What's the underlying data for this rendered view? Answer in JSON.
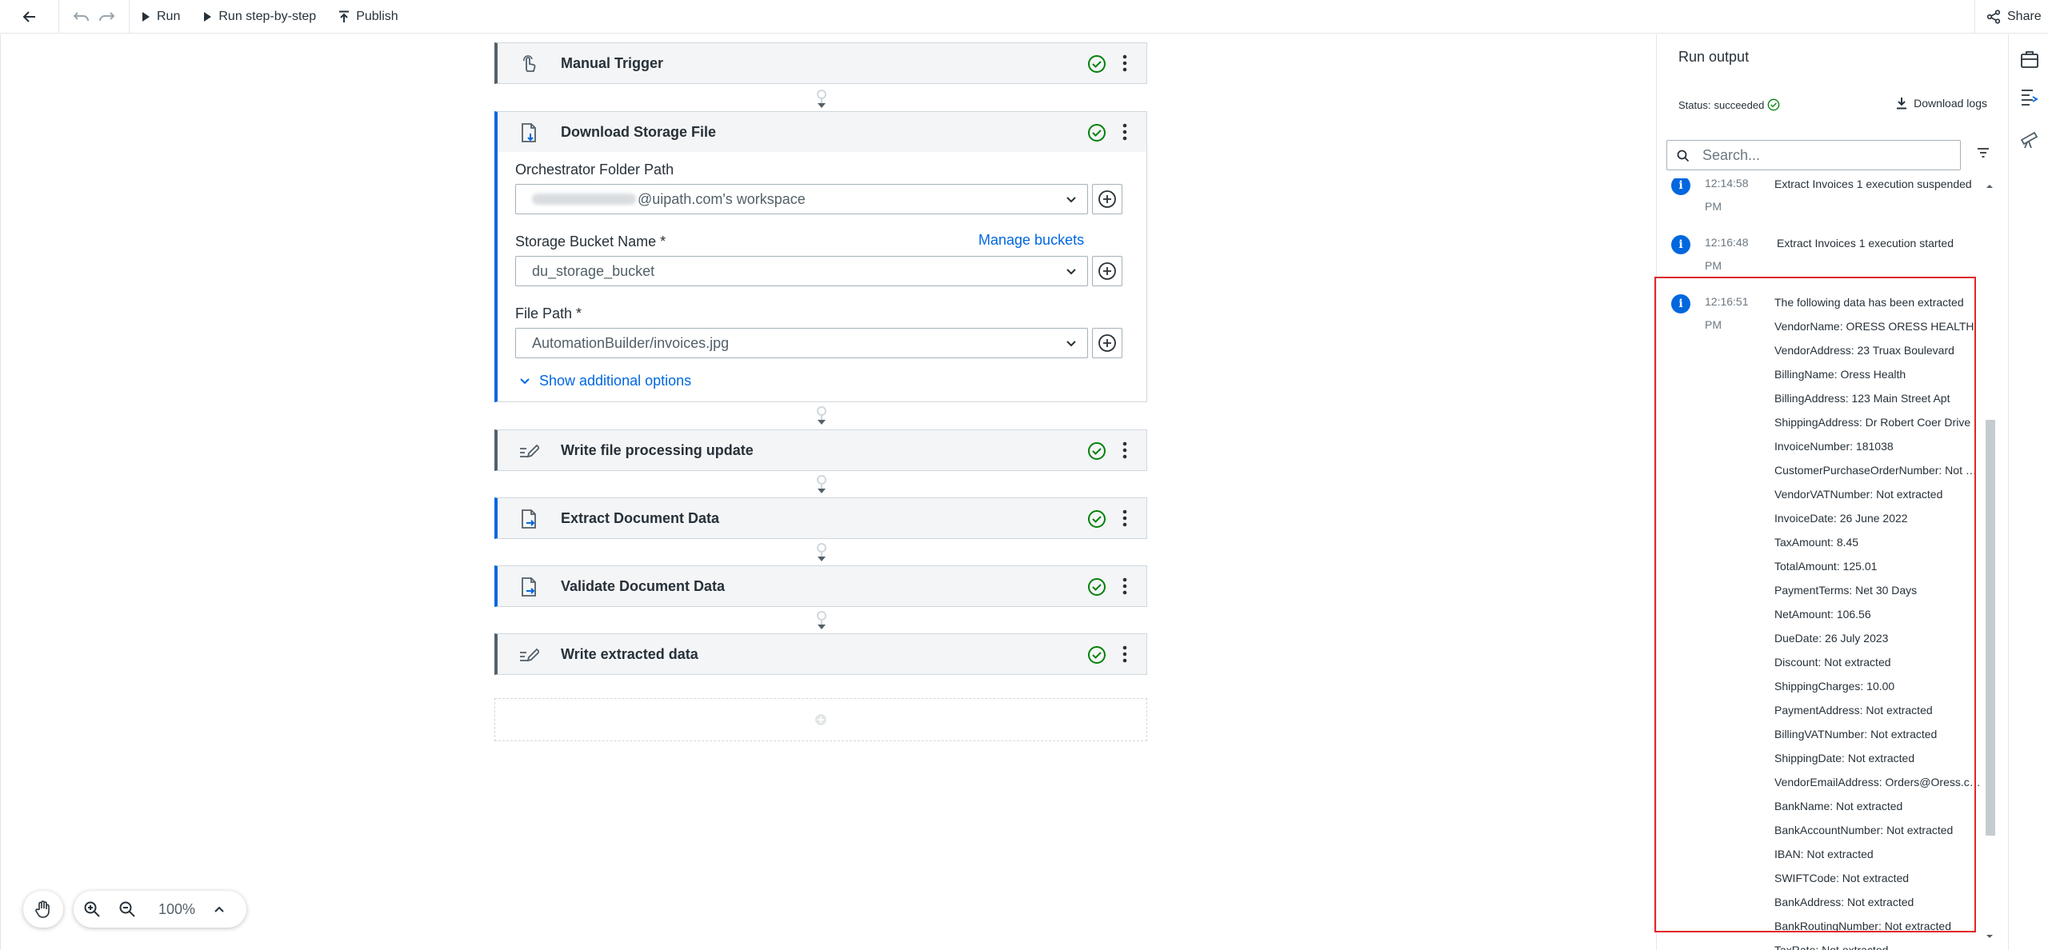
{
  "toolbar": {
    "run_label": "Run",
    "run_step_label": "Run step-by-step",
    "publish_label": "Publish",
    "share_label": "Share"
  },
  "workflow": {
    "nodes": [
      {
        "title": "Manual Trigger"
      },
      {
        "title": "Download Storage File"
      },
      {
        "title": "Write file processing update"
      },
      {
        "title": "Extract Document Data"
      },
      {
        "title": "Validate Document Data"
      },
      {
        "title": "Write extracted data"
      }
    ],
    "download_form": {
      "folder_label": "Orchestrator Folder Path",
      "folder_value": "@uipath.com's workspace",
      "bucket_label": "Storage Bucket Name *",
      "manage_buckets": "Manage buckets",
      "bucket_value": "du_storage_bucket",
      "filepath_label": "File Path *",
      "filepath_value": "AutomationBuilder/invoices.jpg",
      "show_more": "Show additional options"
    }
  },
  "zoom": {
    "level": "100%"
  },
  "run_output": {
    "title": "Run output",
    "status_label": "Status:",
    "status_value": "succeeded",
    "download_logs": "Download logs",
    "search_placeholder": "Search...",
    "entries": [
      {
        "time": "12:14:58 PM",
        "message": "Extract Invoices 1 execution suspended"
      },
      {
        "time": "12:16:48 PM",
        "message": "Extract Invoices 1 execution started"
      },
      {
        "time": "12:16:51 PM",
        "lines": [
          "The following data has been extracted",
          "VendorName: ORESS ORESS HEALTH",
          "VendorAddress: 23 Truax Boulevard",
          "BillingName: Oress Health",
          "BillingAddress: 123 Main Street Apt",
          "ShippingAddress: Dr Robert Coer Drive",
          "InvoiceNumber: 181038",
          "CustomerPurchaseOrderNumber: Not extracted",
          "VendorVATNumber: Not extracted",
          "InvoiceDate: 26 June 2022",
          "TaxAmount: 8.45",
          "TotalAmount: 125.01",
          "PaymentTerms: Net 30 Days",
          "NetAmount: 106.56",
          "DueDate: 26 July 2023",
          "Discount: Not extracted",
          "ShippingCharges: 10.00",
          "PaymentAddress: Not extracted",
          "BillingVATNumber: Not extracted",
          "ShippingDate: Not extracted",
          "VendorEmailAddress: Orders@Oress.com",
          "BankName: Not extracted",
          "BankAccountNumber: Not extracted",
          "IBAN: Not extracted",
          "SWIFTCode: Not extracted",
          "BankAddress: Not extracted",
          "BankRoutingNumber: Not extracted",
          "TaxRate: Not extracted"
        ]
      }
    ]
  },
  "colors": {
    "accent": "#0067df",
    "success": "#038108",
    "highlight": "#e0252b"
  }
}
